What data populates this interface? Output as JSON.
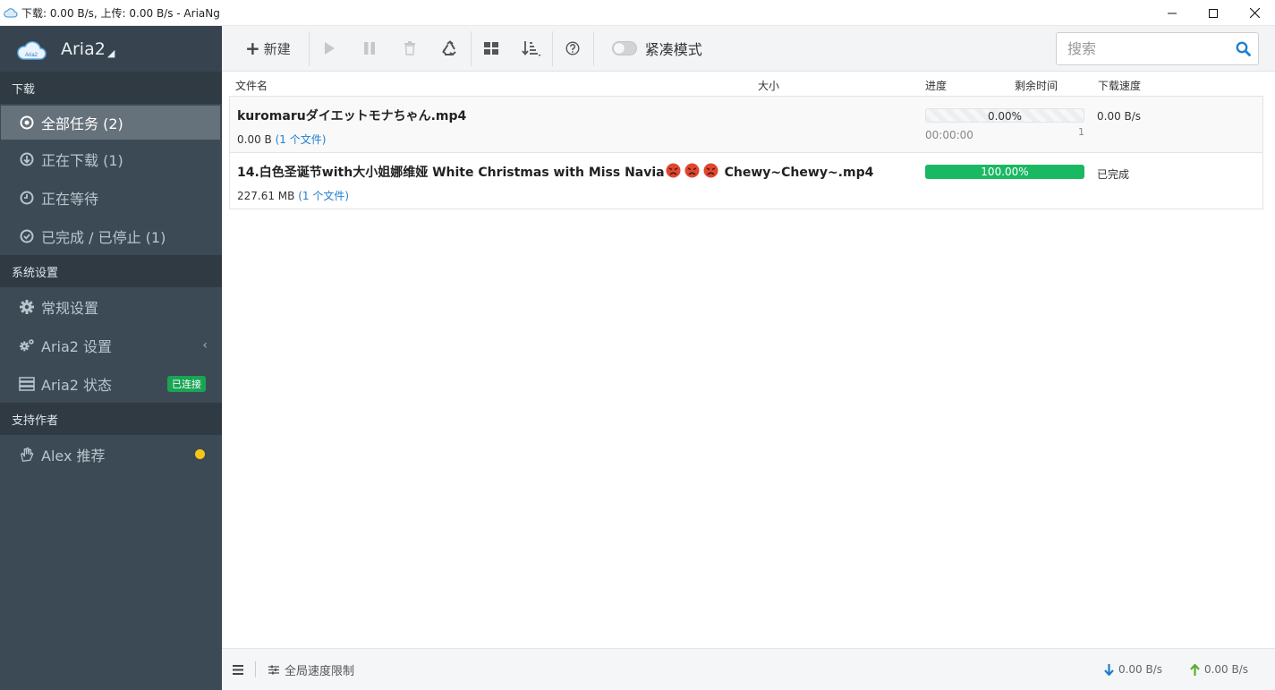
{
  "window": {
    "title": "下载: 0.00 B/s, 上传: 0.00 B/s - AriaNg"
  },
  "brand": {
    "name": "Aria2",
    "logo_text": "Aria2"
  },
  "sidebar": {
    "sections": [
      {
        "header": "下载",
        "items": [
          {
            "label": "全部任务 (2)",
            "icon": "target-icon",
            "active": true
          },
          {
            "label": "正在下载 (1)",
            "icon": "download-circle-icon"
          },
          {
            "label": "正在等待",
            "icon": "clock-icon"
          },
          {
            "label": "已完成 / 已停止 (1)",
            "icon": "check-circle-icon"
          }
        ]
      },
      {
        "header": "系统设置",
        "items": [
          {
            "label": "常规设置",
            "icon": "gear-icon"
          },
          {
            "label": "Aria2 设置",
            "icon": "gears-icon"
          },
          {
            "label": "Aria2 状态",
            "icon": "server-icon",
            "badge": "已连接"
          }
        ]
      },
      {
        "header": "支持作者",
        "items": [
          {
            "label": "Alex 推荐",
            "icon": "hand-icon"
          }
        ]
      }
    ]
  },
  "toolbar": {
    "new_label": "新建",
    "compact_mode_label": "紧凑模式",
    "search_placeholder": "搜索"
  },
  "table": {
    "columns": [
      "文件名",
      "大小",
      "进度",
      "剩余时间",
      "下载速度"
    ],
    "rows": [
      {
        "name": "kuromaruダイエットモナちゃん.mp4",
        "size": "0.00 B",
        "files": "(1 个文件)",
        "progress": 0.0,
        "progress_text": "0.00%",
        "remaining": "00:00:00",
        "connections": "1",
        "speed": "0.00 B/s"
      },
      {
        "name": "14.白色圣诞节with大小姐娜维娅 White Christmas with Miss Navia",
        "name_suffix": "Chewy~Chewy~.mp4",
        "size": "227.61 MB",
        "files": "(1 个文件)",
        "progress": 1.0,
        "progress_text": "100.00%",
        "status": "已完成"
      }
    ]
  },
  "footer": {
    "speed_limit_label": "全局速度限制",
    "download_speed": "0.00 B/s",
    "upload_speed": "0.00 B/s"
  },
  "colors": {
    "sidebar_bg": "#3c4a55",
    "progress_green": "#1bb864",
    "connected_badge": "#19a454",
    "link_blue": "#1e7fd0",
    "search_icon_blue": "#1e7fd0"
  }
}
